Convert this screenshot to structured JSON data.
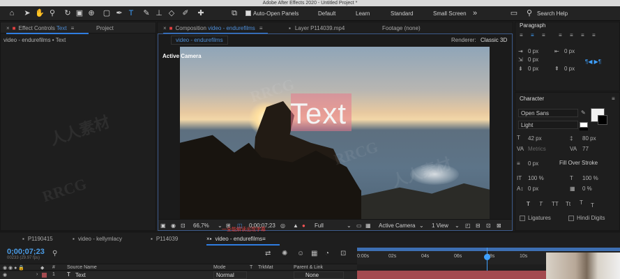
{
  "app": {
    "title": "Adobe After Effects 2020 - Untitled Project *"
  },
  "toolbar": {
    "auto_open_panels": "Auto-Open Panels",
    "workspaces": [
      "Default",
      "Learn",
      "Standard",
      "Small Screen"
    ],
    "search_help": "Search Help"
  },
  "left_panel": {
    "tab_label": "Effect Controls",
    "tab_label_accent": "Text",
    "tab2": "Project",
    "layer_path": "video - endurefilms • Text"
  },
  "comp_panel": {
    "tab_label": "Composition",
    "tab_comp_name": "video - endurefilms",
    "tab_layer": "Layer P114039.mp4",
    "tab_footage": "Footage (none)",
    "sub_tab": "video - endurefilms",
    "renderer_label": "Renderer:",
    "renderer_value": "Classic 3D",
    "active_camera_overlay": "Active Camera",
    "canvas_text": "Text",
    "bottom": {
      "zoom": "66,7%",
      "timecode": "0;00;07;23",
      "resolution": "Full",
      "camera": "Active Camera",
      "view": "1 View",
      "red_caption": "一全能解读出现字幕"
    }
  },
  "paragraph_panel": {
    "title": "Paragraph",
    "values": [
      "0 px",
      "0 px",
      "0 px",
      "0 px",
      "0 px"
    ]
  },
  "character_panel": {
    "title": "Character",
    "font_family": "Open Sans",
    "font_style": "Light",
    "font_size": "42 px",
    "leading": "80 px",
    "kerning": "Metrics",
    "tracking": "77",
    "stroke_width": "0 px",
    "stroke_mode": "Fill Over Stroke",
    "vert_scale": "100 %",
    "horiz_scale": "100 %",
    "baseline": "0 px",
    "tsume": "0 %",
    "ligatures": "Ligatures",
    "hindi_digits": "Hindi Digits",
    "style_buttons": [
      "T",
      "T",
      "TT",
      "Tt",
      "T",
      "T"
    ]
  },
  "timeline": {
    "tabs": [
      "P1190415",
      "video - kellymlacy",
      "P114039",
      "video - endurefilms"
    ],
    "timecode": "0;00;07;23",
    "frame_info": "00233 (29.97 fps)",
    "columns": {
      "num": "#",
      "source": "Source Name",
      "mode": "Mode",
      "t": "T",
      "trkmat": "TrkMat",
      "parent": "Parent & Link"
    },
    "ruler_ticks": [
      "0:00s",
      "02s",
      "04s",
      "06s",
      "08s",
      "10s"
    ],
    "layer": {
      "num": "1",
      "name": "Text",
      "mode": "Normal",
      "parent": "None"
    }
  },
  "colors": {
    "accent": "#2f7de1",
    "label_red": "#a34a4f",
    "text_fill": "#e6788c"
  }
}
